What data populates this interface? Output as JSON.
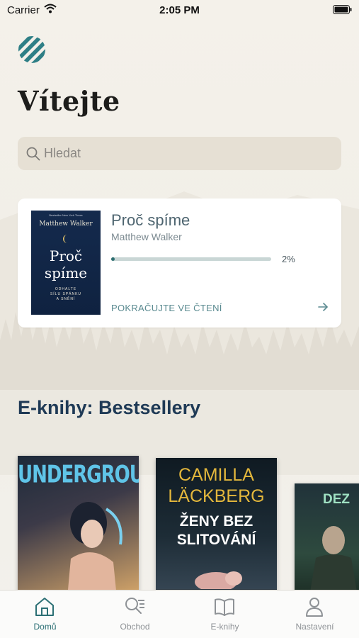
{
  "status_bar": {
    "carrier": "Carrier",
    "time": "2:05 PM"
  },
  "header": {
    "title": "Vítejte"
  },
  "search": {
    "placeholder": "Hledat"
  },
  "reading": {
    "book_title": "Proč spíme",
    "author": "Matthew Walker",
    "progress_percent": 2,
    "progress_label": "2%",
    "continue_label": "POKRAČUJTE VE ČTENÍ",
    "cover": {
      "top_text": "Bestseller New York Times",
      "author": "Matthew Walker",
      "title_line1": "Proč",
      "title_line2": "spíme",
      "subtitle_line1": "ODHALTE",
      "subtitle_line2": "SÍLU SPÁNKU",
      "subtitle_line3": "A SNĚNÍ"
    }
  },
  "bestsellers": {
    "title": "E-knihy: Bestsellery",
    "books": [
      {
        "cover_text": "UNDERGROUND"
      },
      {
        "cover_line1": "CAMILLA",
        "cover_line2": "LÄCKBERG",
        "cover_line3": "ŽENY BEZ",
        "cover_line4": "SLITOVÁNÍ"
      },
      {
        "cover_text": "DEZ"
      }
    ]
  },
  "tabs": [
    {
      "label": "Domů",
      "icon": "home-icon",
      "active": true
    },
    {
      "label": "Obchod",
      "icon": "store-search-icon",
      "active": false
    },
    {
      "label": "E-knihy",
      "icon": "book-icon",
      "active": false
    },
    {
      "label": "Nastavení",
      "icon": "user-icon",
      "active": false
    }
  ],
  "colors": {
    "accent": "#2b6f74",
    "background": "#f4f1ea",
    "card": "#ffffff"
  }
}
